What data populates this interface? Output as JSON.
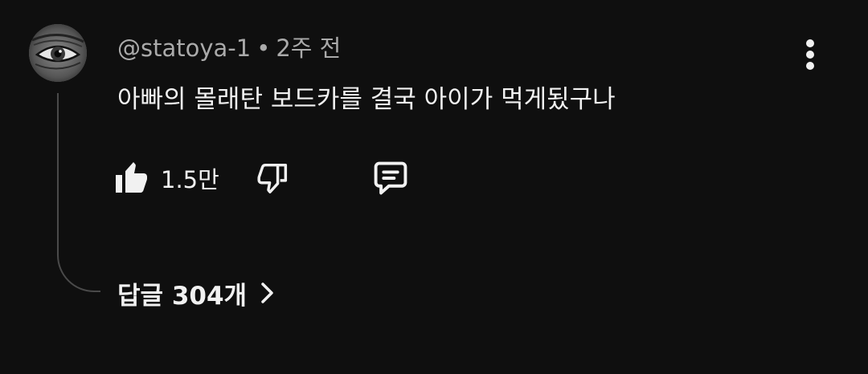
{
  "comment": {
    "author": "@statoya-1",
    "separator": "•",
    "time": "2주 전",
    "text": "아빠의 몰래탄 보드카를 결국 아이가 먹게됬구나",
    "like_count": "1.5만",
    "replies_label": "답글 304개"
  },
  "icons": {
    "avatar": "eye-avatar",
    "more": "more-vertical-icon",
    "like": "thumbs-up-filled-icon",
    "dislike": "thumbs-down-outline-icon",
    "reply": "comment-reply-icon",
    "chevron": "chevron-right-icon"
  },
  "colors": {
    "background": "#0f0f0f",
    "text_primary": "#f1f1f1",
    "text_secondary": "#aaaaaa",
    "thread_line": "#4a4a4a"
  }
}
